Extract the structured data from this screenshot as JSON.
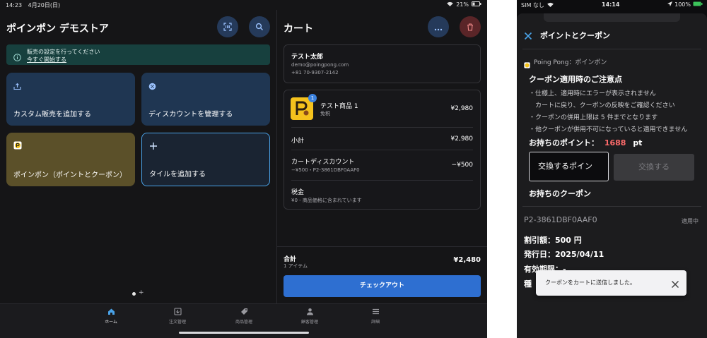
{
  "tablet": {
    "status": {
      "time": "14:23",
      "date": "4月20日(日)",
      "battery": "21%"
    },
    "store_title": "ポインポン デモストア",
    "banner": {
      "text": "販売の設定を行ってください",
      "link": "今すぐ開始する"
    },
    "tiles": [
      {
        "label": "カスタム販売を追加する",
        "icon": "upload-tray-icon",
        "color": "#1e3550"
      },
      {
        "label": "ディスカウントを管理する",
        "icon": "discount-badge-icon",
        "color": "#1e3550"
      },
      {
        "label": "ポインポン（ポイントとクーポン）",
        "icon": "poingpong-logo-icon",
        "color": "#5a4f28"
      },
      {
        "label": "タイルを追加する",
        "icon": "plus-icon",
        "color": "#1a2638"
      }
    ],
    "cart": {
      "title": "カート",
      "customer": {
        "name": "テスト太郎",
        "email": "demo@poingpong.com",
        "phone": "+81 70-9307-2142"
      },
      "item": {
        "name": "テスト商品 1",
        "tax_note": "免税",
        "price": "¥2,980",
        "qty_badge": "1"
      },
      "subtotal": {
        "label": "小計",
        "value": "¥2,980"
      },
      "discount": {
        "label": "カートディスカウント",
        "detail": "−¥500・P2-3861DBF0AAF0",
        "value": "−¥500"
      },
      "tax": {
        "label": "税金",
        "detail": "¥0 - 商品価格に含まれています"
      },
      "total": {
        "label": "合計",
        "items": "1 アイテム",
        "value": "¥2,480"
      },
      "checkout": "チェックアウト"
    },
    "nav": [
      {
        "label": "ホーム",
        "icon": "home-icon",
        "active": true
      },
      {
        "label": "注文管理",
        "icon": "orders-icon",
        "active": false
      },
      {
        "label": "商品管理",
        "icon": "tag-icon",
        "active": false
      },
      {
        "label": "顧客管理",
        "icon": "person-icon",
        "active": false
      },
      {
        "label": "詳細",
        "icon": "menu-icon",
        "active": false
      }
    ]
  },
  "phone": {
    "status": {
      "carrier": "SIM なし",
      "time": "14:14",
      "battery": "100%"
    },
    "header_title": "ポイントとクーポン",
    "source": "Poing Pong：ポインポン",
    "notice_title": "クーポン適用時のご注意点",
    "notice_lines": [
      "・仕様上、適用時にエラーが表示されません",
      "　カートに戻り、クーポンの反映をご確認ください",
      "・クーポンの併用上限は 5 件までとなります",
      "・他クーポンが併用不可になっていると適用できません"
    ],
    "points": {
      "label": "お持ちのポイント：",
      "value": "1688",
      "unit": "pt"
    },
    "exchange_input_placeholder": "交換するポイン",
    "exchange_button": "交換する",
    "coupons_title": "お持ちのクーポン",
    "coupon": {
      "code": "P2-3861DBF0AAF0",
      "status": "適用中",
      "discount": "割引額：500 円",
      "issued": "発行日：2025/04/11",
      "expiry": "有効期限：-",
      "type_partial": "種"
    },
    "toast": "クーポンをカートに送信しました。"
  }
}
